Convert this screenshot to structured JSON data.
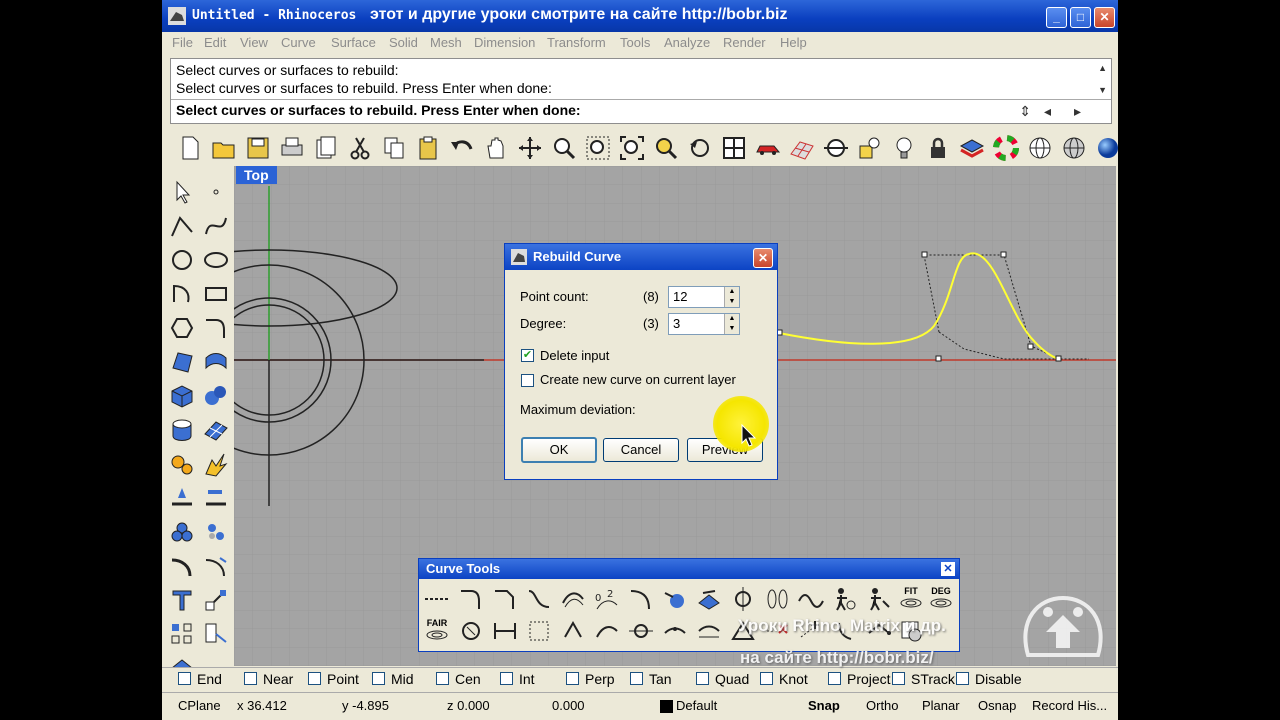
{
  "window": {
    "title": "Untitled - Rhinoceros",
    "title_note": "этот и другие уроки смотрите на сайте http://bobr.biz"
  },
  "menu": [
    "File",
    "Edit",
    "View",
    "Curve",
    "Surface",
    "Solid",
    "Mesh",
    "Dimension",
    "Transform",
    "Tools",
    "Analyze",
    "Render",
    "Help"
  ],
  "command": {
    "history": [
      "Select curves or surfaces to rebuild:",
      "Select curves or surfaces to rebuild. Press Enter when done:"
    ],
    "prompt": "Select curves or surfaces to rebuild. Press Enter when done:"
  },
  "viewport": {
    "label": "Top"
  },
  "dialog": {
    "title": "Rebuild Curve",
    "point_count_label": "Point count:",
    "point_count_orig": "(8)",
    "point_count_value": "12",
    "degree_label": "Degree:",
    "degree_orig": "(3)",
    "degree_value": "3",
    "delete_input_label": "Delete input",
    "delete_input_checked": true,
    "new_layer_label": "Create new curve on current layer",
    "new_layer_checked": false,
    "max_dev_label": "Maximum deviation:",
    "ok": "OK",
    "cancel": "Cancel",
    "preview": "Preview"
  },
  "curve_tools": {
    "title": "Curve Tools",
    "row1_labels": {
      "fit": "FIT",
      "deg": "DEG"
    },
    "row2_labels": {
      "fair": "FAIR"
    }
  },
  "osnap": [
    {
      "label": "End",
      "checked": false
    },
    {
      "label": "Near",
      "checked": false
    },
    {
      "label": "Point",
      "checked": false
    },
    {
      "label": "Mid",
      "checked": false
    },
    {
      "label": "Cen",
      "checked": false
    },
    {
      "label": "Int",
      "checked": false
    },
    {
      "label": "Perp",
      "checked": false
    },
    {
      "label": "Tan",
      "checked": false
    },
    {
      "label": "Quad",
      "checked": false
    },
    {
      "label": "Knot",
      "checked": false
    },
    {
      "label": "Project",
      "checked": false
    },
    {
      "label": "STrack",
      "checked": false
    },
    {
      "label": "Disable",
      "checked": false
    }
  ],
  "status": {
    "cplane": "CPlane",
    "x": "x 36.412",
    "y": "y -4.895",
    "z": "z 0.000",
    "extra": "0.000",
    "layer": "Default",
    "snap": "Snap",
    "ortho": "Ortho",
    "planar": "Planar",
    "osnap": "Osnap",
    "record": "Record His..."
  },
  "watermark": {
    "line1": "Уроки Rhino, Matrix и др.",
    "line2": "на сайте http://bobr.biz/"
  },
  "colors": {
    "titlebar": "#0a3fbf",
    "viewport_bg": "#a4a4a4",
    "curve_selected": "#ffff33",
    "x_axis": "#c0392b",
    "y_axis": "#2e9e2e"
  }
}
